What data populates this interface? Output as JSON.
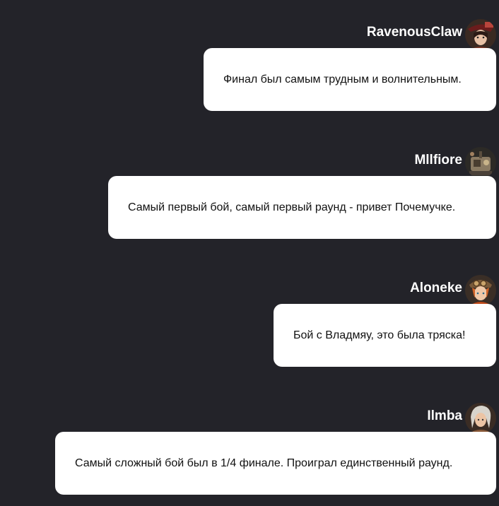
{
  "messages": [
    {
      "author": "RavenousClaw",
      "avatar_icon": "avatar-hat-girl-icon",
      "text": "Финал был самым трудным и волнительным."
    },
    {
      "author": "Mllfiore",
      "avatar_icon": "avatar-machine-icon",
      "text": "Самый первый бой, самый первый раунд - привет Почемучке."
    },
    {
      "author": "Aloneke",
      "avatar_icon": "avatar-goggles-icon",
      "text": "Бой с Владмяу, это была тряска!"
    },
    {
      "author": "Ilmba",
      "avatar_icon": "avatar-white-hair-icon",
      "text": "Самый сложный бой был в 1/4 финале. Проиграл единственный раунд."
    }
  ],
  "colors": {
    "background": "#232329",
    "bubble": "#ffffff",
    "author_text": "#ffffff",
    "message_text": "#111111"
  }
}
